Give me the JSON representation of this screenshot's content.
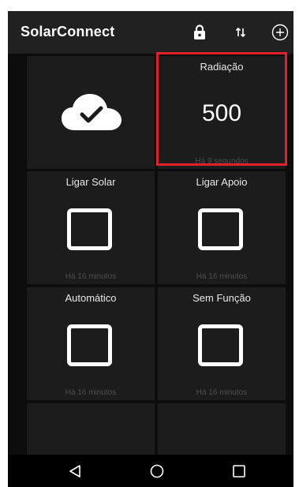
{
  "appbar": {
    "title": "SolarConnect",
    "icons": [
      "lock-icon",
      "sort-arrows-icon",
      "add-circle-icon"
    ]
  },
  "tiles": [
    {
      "kind": "status",
      "icon": "cloud-check-icon"
    },
    {
      "kind": "value",
      "title": "Radiação",
      "value": "500",
      "time": "Há 9 segundos",
      "highlighted": true
    },
    {
      "kind": "switch",
      "title": "Ligar Solar",
      "time": "Há 16 minutos",
      "checked": false
    },
    {
      "kind": "switch",
      "title": "Ligar Apoio",
      "time": "Há 16 minutos",
      "checked": false
    },
    {
      "kind": "switch",
      "title": "Automático",
      "time": "Há 16 minutos",
      "checked": false
    },
    {
      "kind": "switch",
      "title": "Sem Função",
      "time": "Há 16 minutos",
      "checked": false
    },
    {
      "kind": "empty"
    },
    {
      "kind": "empty"
    }
  ],
  "navbar": {
    "buttons": [
      "back-icon",
      "home-icon",
      "recents-icon"
    ]
  },
  "colors": {
    "appbar": "#212121",
    "tile": "#1c1c1c",
    "highlight": "#e0202a"
  }
}
